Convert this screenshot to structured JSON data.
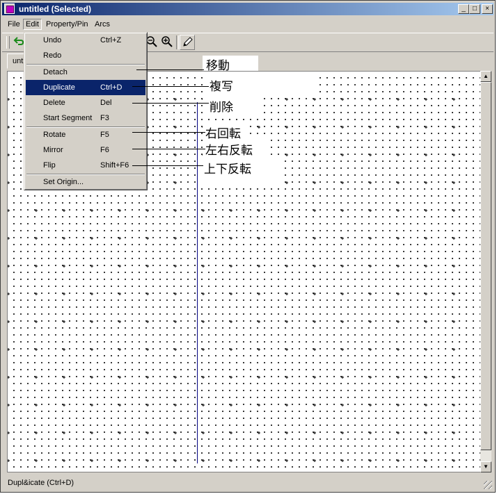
{
  "window": {
    "title": "untitled (Selected)"
  },
  "title_buttons": {
    "minimize": "_",
    "maximize": "□",
    "close": "×"
  },
  "menubar": {
    "items": [
      "File",
      "Edit",
      "Property/Pin",
      "Arcs"
    ]
  },
  "tab": {
    "label": "unt"
  },
  "edit_menu": {
    "items": [
      {
        "label": "Undo",
        "shortcut": "Ctrl+Z"
      },
      {
        "label": "Redo",
        "shortcut": ""
      },
      {
        "label": "Detach",
        "shortcut": ""
      },
      {
        "label": "Duplicate",
        "shortcut": "Ctrl+D",
        "selected": true
      },
      {
        "label": "Delete",
        "shortcut": "Del"
      },
      {
        "label": "Start Segment",
        "shortcut": "F3"
      },
      {
        "label": "Rotate",
        "shortcut": "F5"
      },
      {
        "label": "Mirror",
        "shortcut": "F6"
      },
      {
        "label": "Flip",
        "shortcut": "Shift+F6"
      },
      {
        "label": "Set Origin...",
        "shortcut": ""
      }
    ]
  },
  "annotations": [
    "移動",
    "複写",
    "削除",
    "右回転",
    "左右反転",
    "上下反転"
  ],
  "statusbar": {
    "text": "Dupl&icate (Ctrl+D)"
  },
  "scrollbar": {
    "up": "▲",
    "down": "▼"
  },
  "colors": {
    "titlebar": "#0a246a",
    "selection": "#0a246a",
    "line": "#000080"
  }
}
